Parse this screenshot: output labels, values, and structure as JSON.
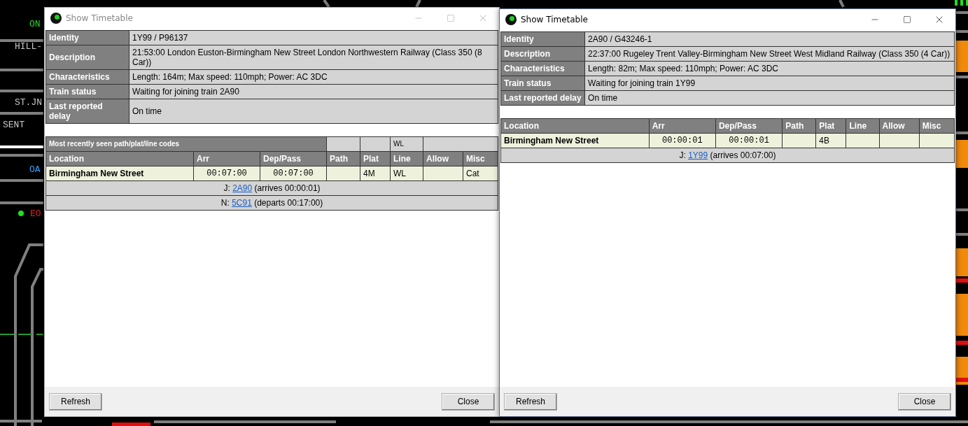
{
  "background_labels": [
    "ON",
    "HILL-",
    "ST.JN",
    "SENT",
    "OA",
    "EO"
  ],
  "windows": [
    {
      "title": "Show Timetable",
      "active": false,
      "info": [
        {
          "label": "Identity",
          "value": "1Y99 / P96137"
        },
        {
          "label": "Description",
          "value": "21:53:00 London Euston-Birmingham New Street London Northwestern Railway (Class 350 (8 Car))"
        },
        {
          "label": "Characteristics",
          "value": "Length: 164m; Max speed: 110mph; Power: AC 3DC"
        },
        {
          "label": "Train status",
          "value": "Waiting for joining train 2A90"
        },
        {
          "label": "Last reported delay",
          "value": "On time"
        }
      ],
      "path_codes": {
        "label": "Most recently seen path/plat/line codes",
        "line": "WL"
      },
      "columns": [
        "Location",
        "Arr",
        "Dep/Pass",
        "Path",
        "Plat",
        "Line",
        "Allow",
        "Misc"
      ],
      "rows": [
        {
          "location": "Birmingham New Street",
          "arr": "00:07:00",
          "dep": "00:07:00",
          "path": "",
          "plat": "4M",
          "line": "WL",
          "allow": "",
          "misc": "Cat"
        }
      ],
      "notes": [
        {
          "prefix": "J:",
          "link": "2A90",
          "suffix": "(arrives 00:00:01)"
        },
        {
          "prefix": "N:",
          "link": "5C91",
          "suffix": "(departs 00:17:00)"
        }
      ],
      "buttons": [
        "Refresh",
        "Close"
      ]
    },
    {
      "title": "Show Timetable",
      "active": true,
      "info": [
        {
          "label": "Identity",
          "value": "2A90 / G43246-1"
        },
        {
          "label": "Description",
          "value": "22:37:00 Rugeley Trent Valley-Birmingham New Street West Midland Railway (Class 350 (4 Car))"
        },
        {
          "label": "Characteristics",
          "value": "Length: 82m; Max speed: 110mph; Power: AC 3DC"
        },
        {
          "label": "Train status",
          "value": "Waiting for joining train 1Y99"
        },
        {
          "label": "Last reported delay",
          "value": "On time"
        }
      ],
      "columns": [
        "Location",
        "Arr",
        "Dep/Pass",
        "Path",
        "Plat",
        "Line",
        "Allow",
        "Misc"
      ],
      "rows": [
        {
          "location": "Birmingham New Street",
          "arr": "00:00:01",
          "dep": "00:00:01",
          "path": "",
          "plat": "4B",
          "line": "",
          "allow": "",
          "misc": ""
        }
      ],
      "notes": [
        {
          "prefix": "J:",
          "link": "1Y99",
          "suffix": "(arrives 00:07:00)"
        }
      ],
      "buttons": [
        "Refresh",
        "Close"
      ]
    }
  ]
}
